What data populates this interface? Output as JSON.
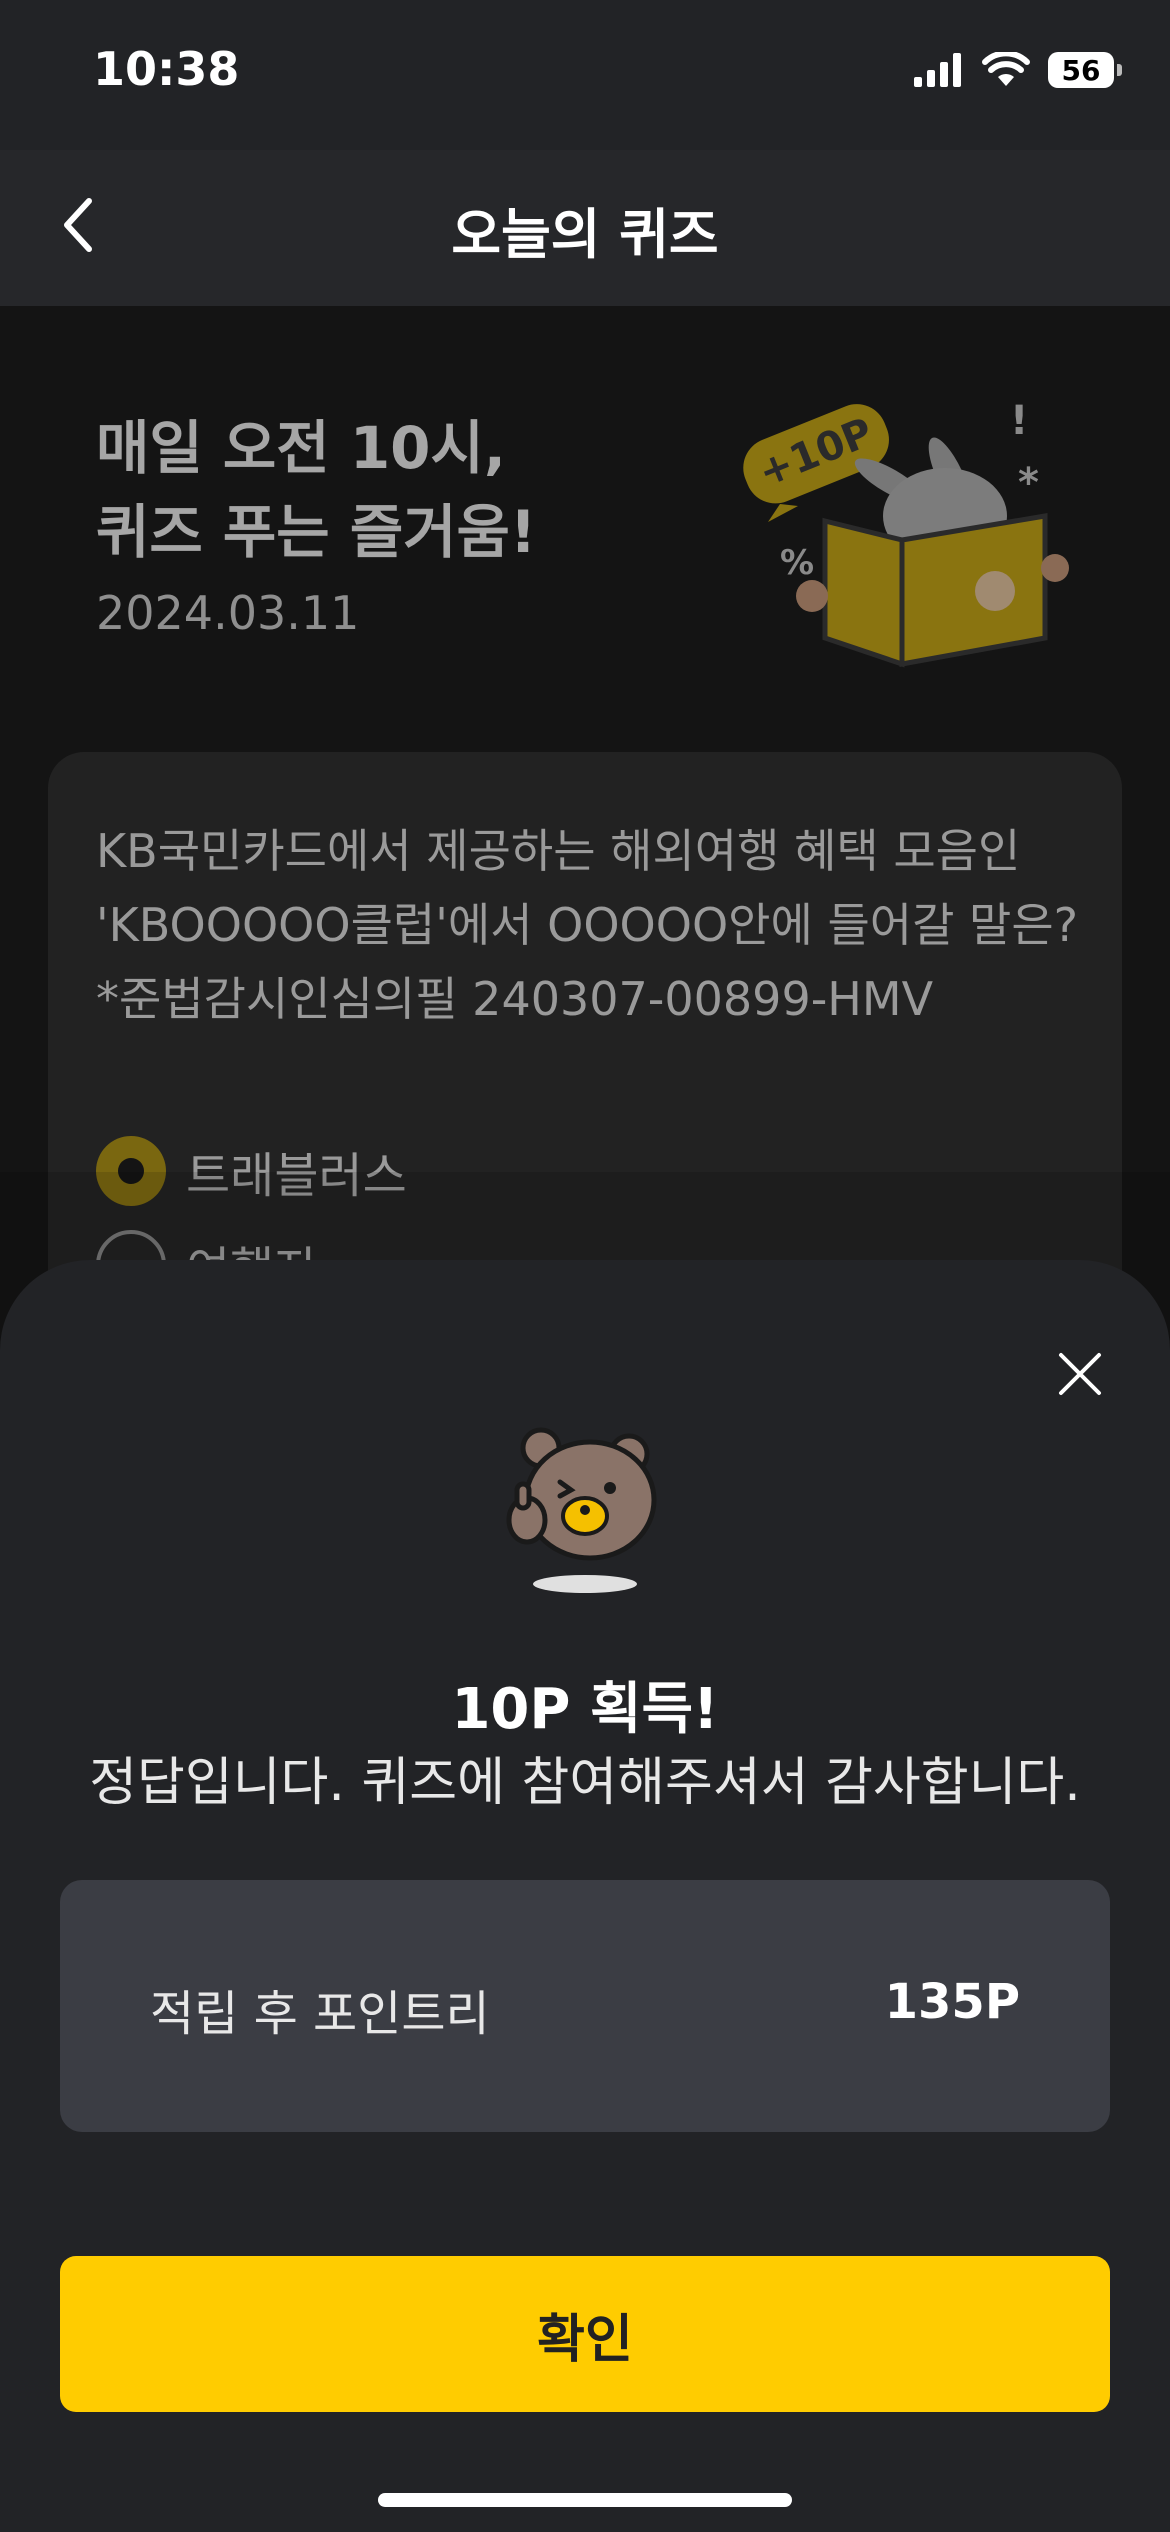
{
  "status_bar": {
    "time": "10:38",
    "battery": "56"
  },
  "header": {
    "title": "오늘의 퀴즈"
  },
  "hero": {
    "title_line1": "매일 오전 10시,",
    "title_line2": "퀴즈 푸는 즐거움!",
    "date": "2024.03.11",
    "badge": "+10P"
  },
  "quiz": {
    "question_line1": "KB국민카드에서 제공하는 해외여행 혜택 모음인",
    "question_line2": "'KBOOOOO클럽'에서 OOOOO안에 들어갈 말은?",
    "question_line3": "*준법감시인심의필 240307-00899-HMV",
    "options": [
      {
        "label": "트래블러스",
        "selected": true
      },
      {
        "label": "여행자",
        "selected": false
      }
    ]
  },
  "result_sheet": {
    "title": "10P 획득!",
    "message": "정답입니다. 퀴즈에 참여해주셔서 감사합니다.",
    "points_label": "적립 후 포인트리",
    "points_value": "135P",
    "confirm_label": "확인"
  },
  "colors": {
    "accent": "#ffcc00",
    "sheet_bg": "#222326",
    "points_box": "#3b3d44"
  }
}
